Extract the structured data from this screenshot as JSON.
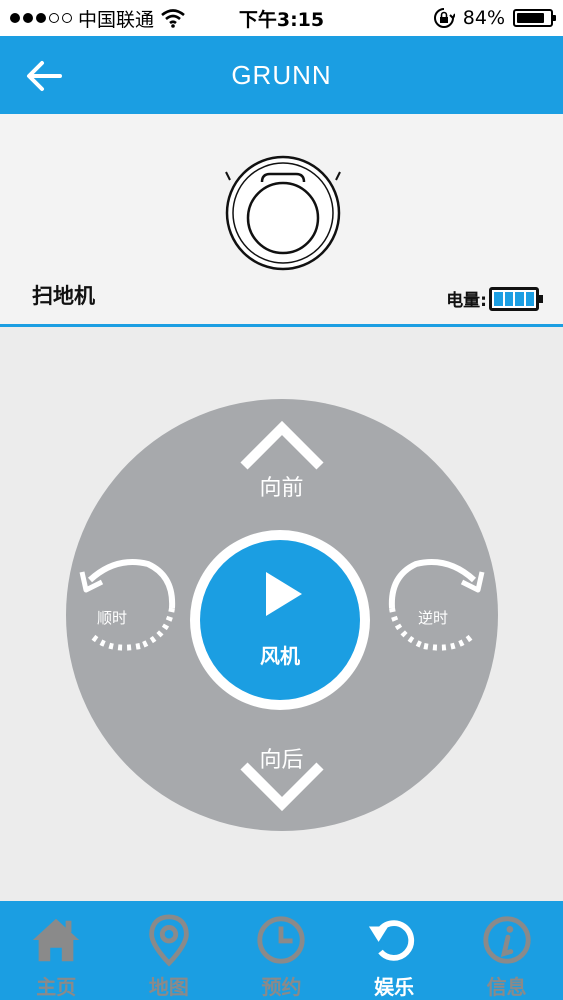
{
  "status_bar": {
    "carrier": "中国联通",
    "time": "下午3:15",
    "battery_percent": "84%",
    "battery_level": 0.84,
    "signal_bars_filled": 3,
    "signal_bars_total": 5
  },
  "header": {
    "title": "GRUNN",
    "back_icon": "arrow-left-icon"
  },
  "device": {
    "name": "扫地机",
    "battery_label": "电量:",
    "battery_level": 1.0,
    "icon": "robot-vacuum-icon"
  },
  "controls": {
    "forward_label": "向前",
    "back_label": "向后",
    "clockwise_label": "顺时",
    "counterclockwise_label": "逆时",
    "center_label": "风机",
    "center_icon": "play-icon"
  },
  "tabs": [
    {
      "label": "主页",
      "icon": "home-icon",
      "active": false
    },
    {
      "label": "地图",
      "icon": "map-pin-icon",
      "active": false
    },
    {
      "label": "预约",
      "icon": "clock-icon",
      "active": false
    },
    {
      "label": "娱乐",
      "icon": "refresh-icon",
      "active": true
    },
    {
      "label": "信息",
      "icon": "info-icon",
      "active": false
    }
  ],
  "colors": {
    "accent": "#1b9ee2",
    "pad": "#a7a9ac",
    "tab_inactive": "#8a8a8a"
  }
}
